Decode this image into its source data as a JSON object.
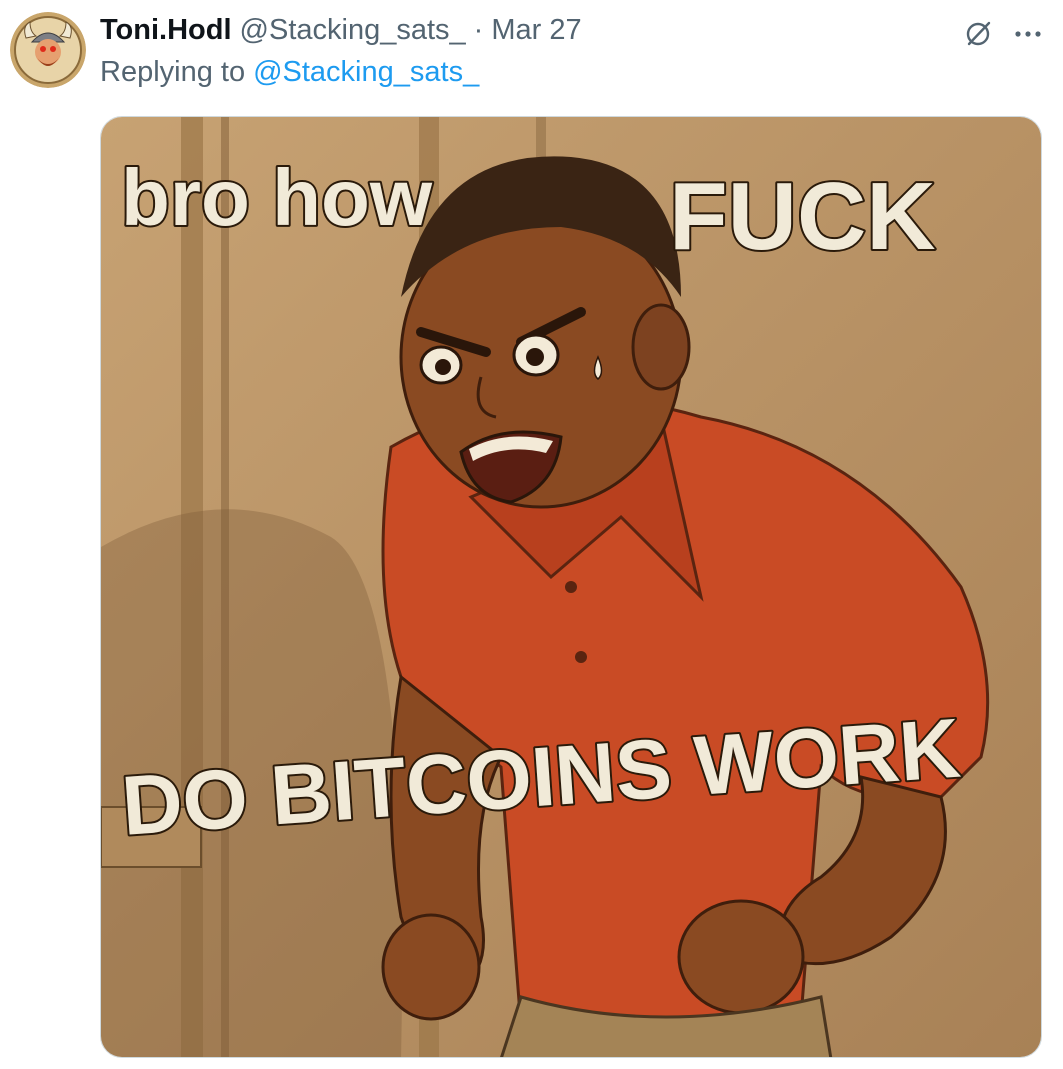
{
  "author": {
    "display_name": "Toni.Hodl",
    "handle": "@Stacking_sats_",
    "separator": "·",
    "date": "Mar 27"
  },
  "reply": {
    "prefix": "Replying to",
    "mention": "@Stacking_sats_"
  },
  "header_icons": {
    "grok": "grok-icon",
    "more": "more-options-icon"
  },
  "media": {
    "meme_text_top_left": "bro how",
    "meme_text_top_right": "FUCK",
    "meme_text_bottom": "DO BITCOINS WORK"
  },
  "colors": {
    "link": "#1d9bf0",
    "secondary_text": "#536471",
    "primary_text": "#0f1419",
    "shirt": "#c94b25",
    "background": "#b38d5e"
  }
}
